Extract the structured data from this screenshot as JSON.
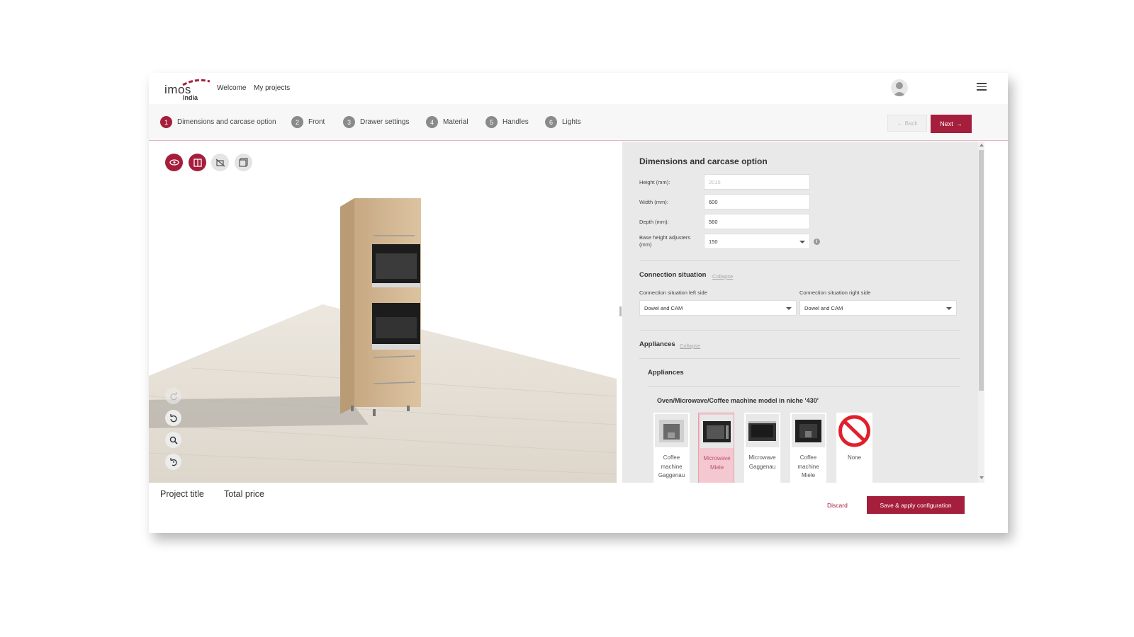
{
  "header": {
    "logo_word": "imos",
    "logo_sub": "India",
    "nav": [
      "Welcome",
      "My projects"
    ]
  },
  "steps": [
    {
      "num": "1",
      "label": "Dimensions and carcase option",
      "active": true
    },
    {
      "num": "2",
      "label": "Front"
    },
    {
      "num": "3",
      "label": "Drawer settings"
    },
    {
      "num": "4",
      "label": "Material"
    },
    {
      "num": "5",
      "label": "Handles"
    },
    {
      "num": "6",
      "label": "Lights"
    }
  ],
  "buttons": {
    "back": "Back",
    "next": "Next",
    "discard": "Discard",
    "save": "Save & apply configuration"
  },
  "icons": {
    "view": "eye-icon",
    "front": "door-icon",
    "hide_front": "hide-door-icon",
    "wireframe": "cube-icon",
    "redo": "redo-icon",
    "undo": "undo-icon",
    "zoom": "magnifier-icon",
    "reset": "reset-view-icon",
    "avatar": "user-icon",
    "menu": "hamburger-icon",
    "info": "info-icon"
  },
  "panel": {
    "title": "Dimensions and carcase option",
    "fields": [
      {
        "label": "Height (mm):",
        "value": "2015"
      },
      {
        "label": "Width (mm):",
        "value": "600"
      },
      {
        "label": "Depth (mm):",
        "value": "560"
      },
      {
        "label": "Base height adjusters (mm)",
        "value": "150"
      }
    ],
    "connection": {
      "title": "Connection situation",
      "collapse": "Collapse",
      "left_label": "Connection situation left side",
      "left_value": "Dowel and CAM",
      "right_label": "Connection situation right side",
      "right_value": "Dowel and CAM"
    },
    "appliances": {
      "title": "Appliances",
      "collapse": "Collapse",
      "sub_title": "Appliances",
      "niche_title": "Oven/Microwave/Coffee machine model in niche '430'",
      "options": [
        {
          "label": "Coffee machine Gaggenau"
        },
        {
          "label": "Microwave Miele",
          "selected": true
        },
        {
          "label": "Microwave Gaggenau"
        },
        {
          "label": "Coffee machine Miele"
        },
        {
          "label": "None"
        }
      ]
    }
  },
  "footer": {
    "project_title": "Project title",
    "total_price": "Total price"
  },
  "colors": {
    "accent": "#a51e3c",
    "panel_bg": "#e9e9e9",
    "selected_card": "#f4c8d0"
  }
}
